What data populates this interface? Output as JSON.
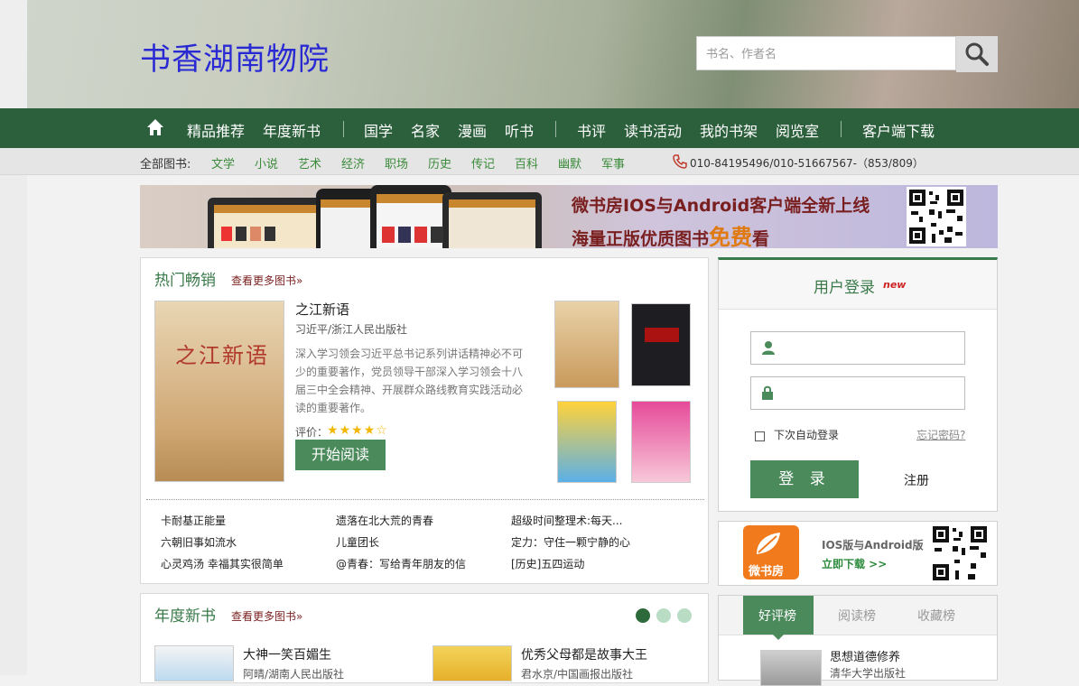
{
  "header": {
    "site_title": "书香湖南物院",
    "search_placeholder": "书名、作者名"
  },
  "nav": {
    "items": [
      "精品推荐",
      "年度新书",
      "国学",
      "名家",
      "漫画",
      "听书",
      "书评",
      "读书活动",
      "我的书架",
      "阅览室",
      "客户端下载"
    ]
  },
  "categories": {
    "label": "全部图书:",
    "items": [
      "文学",
      "小说",
      "艺术",
      "经济",
      "职场",
      "历史",
      "传记",
      "百科",
      "幽默",
      "军事"
    ],
    "phone": "010-84195496/010-51667567-（853/809）"
  },
  "banner": {
    "line1": "微书房IOS与Android客户端全新上线",
    "line2_prefix": "海量正版优质图书",
    "line2_highlight": "免费",
    "line2_suffix": "看"
  },
  "hot": {
    "title": "热门畅销",
    "more": "查看更多图书»",
    "featured": {
      "cover_title": "之江新语",
      "title": "之江新语",
      "author": "习近平/浙江人民出版社",
      "description": "深入学习领会习近平总书记系列讲话精神必不可少的重要著作，党员领导干部深入学习领会十八届三中全会精神、开展群众路线教育实践活动必读的重要著作。",
      "rating_label": "评价：",
      "rating": 4,
      "rating_max": 5,
      "read_button": "开始阅读"
    },
    "list": [
      "卡耐基正能量",
      "遗落在北大荒的青春",
      "超级时间整理术:每天...",
      "六朝旧事如流水",
      "儿童团长",
      "定力：守住一颗宁静的心",
      "心灵鸡汤 幸福其实很简单",
      "@青春：写给青年朋友的信",
      "[历史]五四运动"
    ]
  },
  "login": {
    "title": "用户登录",
    "badge": "new",
    "remember_label": "下次自动登录",
    "forgot_label": "忘记密码?",
    "login_button": "登 录",
    "register_label": "注册"
  },
  "app_ad": {
    "logo_text": "微书房",
    "line1": "IOS版与Android版",
    "line2": "立即下载 >>"
  },
  "annual": {
    "title": "年度新书",
    "more": "查看更多图书»",
    "books": [
      {
        "title": "大神一笑百媚生",
        "author": "阿晴/湖南人民出版社"
      },
      {
        "title": "优秀父母都是故事大王",
        "author": "君水京/中国画报出版社"
      }
    ]
  },
  "ranks": {
    "tabs": [
      "好评榜",
      "阅读榜",
      "收藏榜"
    ],
    "active_tab": "好评榜",
    "top_book": {
      "title": "思想道德修养",
      "publisher": "清华大学出版社"
    }
  },
  "colors": {
    "nav_green": "#2c5f3c",
    "button_green": "#4b8a5b",
    "title_blue": "#2a2ad4",
    "link_green": "#3a8a3a",
    "banner_red": "#7a1f1f"
  },
  "icons": [
    "home-icon",
    "search-icon",
    "phone-icon",
    "user-icon",
    "lock-icon",
    "qr-code-icon"
  ]
}
